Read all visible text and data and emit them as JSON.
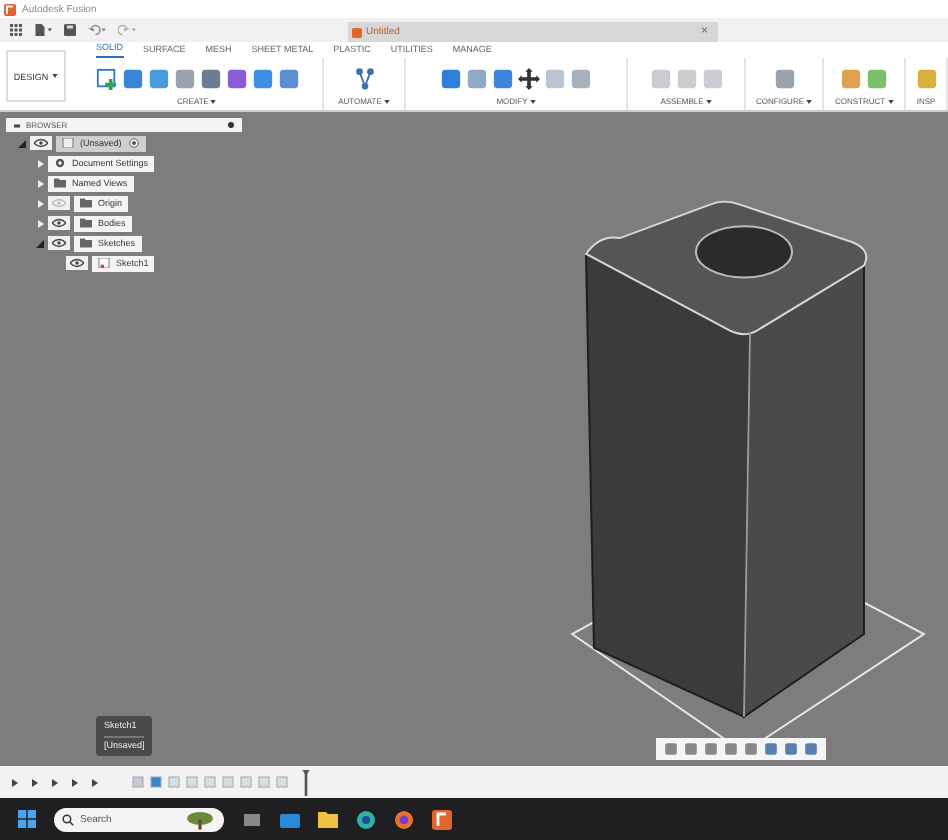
{
  "app_title": "Autodesk Fusion",
  "document_tab": {
    "title": "Untitled",
    "close": "×"
  },
  "workspace": {
    "label": "DESIGN"
  },
  "ribbon_tabs": [
    {
      "label": "SOLID",
      "selected": true
    },
    {
      "label": "SURFACE",
      "selected": false
    },
    {
      "label": "MESH",
      "selected": false
    },
    {
      "label": "SHEET METAL",
      "selected": false
    },
    {
      "label": "PLASTIC",
      "selected": false
    },
    {
      "label": "UTILITIES",
      "selected": false
    },
    {
      "label": "MANAGE",
      "selected": false
    }
  ],
  "ribbon_groups": [
    {
      "label": "CREATE"
    },
    {
      "label": "AUTOMATE"
    },
    {
      "label": "MODIFY"
    },
    {
      "label": "ASSEMBLE"
    },
    {
      "label": "CONFIGURE"
    },
    {
      "label": "CONSTRUCT"
    },
    {
      "label": "INSP"
    }
  ],
  "browser": {
    "title": "BROWSER",
    "tree": [
      {
        "kind": "component",
        "label": "(Unsaved)",
        "expanded": true,
        "visible": true,
        "children": [
          {
            "kind": "settings",
            "label": "Document Settings",
            "expanded": false
          },
          {
            "kind": "folder",
            "label": "Named Views",
            "expanded": false
          },
          {
            "kind": "folder",
            "label": "Origin",
            "expanded": false,
            "visible": false
          },
          {
            "kind": "folder",
            "label": "Bodies",
            "expanded": false,
            "visible": true
          },
          {
            "kind": "folder",
            "label": "Sketches",
            "expanded": true,
            "visible": true,
            "children": [
              {
                "kind": "sketch",
                "label": "Sketch1",
                "visible": true
              }
            ]
          }
        ]
      }
    ]
  },
  "timeline_tooltip": {
    "title": "Sketch1",
    "subtitle": "[Unsaved]"
  },
  "taskbar": {
    "search": {
      "placeholder": "Search"
    }
  }
}
